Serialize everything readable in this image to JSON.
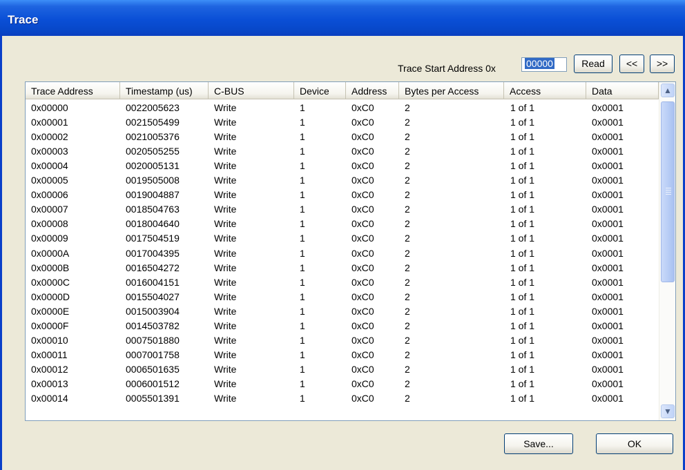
{
  "window": {
    "title": "Trace"
  },
  "toolbar": {
    "start_label": "Trace Start Address 0x",
    "start_value": "00000",
    "read_label": "Read",
    "prev_label": "<<",
    "next_label": ">>"
  },
  "table": {
    "columns": [
      "Trace Address",
      "Timestamp (us)",
      "C-BUS",
      "Device",
      "Address",
      "Bytes per Access",
      "Access",
      "Data"
    ],
    "rows": [
      [
        "0x00000",
        "0022005623",
        "Write",
        "1",
        "0xC0",
        "2",
        "1 of 1",
        "0x0001"
      ],
      [
        "0x00001",
        "0021505499",
        "Write",
        "1",
        "0xC0",
        "2",
        "1 of 1",
        "0x0001"
      ],
      [
        "0x00002",
        "0021005376",
        "Write",
        "1",
        "0xC0",
        "2",
        "1 of 1",
        "0x0001"
      ],
      [
        "0x00003",
        "0020505255",
        "Write",
        "1",
        "0xC0",
        "2",
        "1 of 1",
        "0x0001"
      ],
      [
        "0x00004",
        "0020005131",
        "Write",
        "1",
        "0xC0",
        "2",
        "1 of 1",
        "0x0001"
      ],
      [
        "0x00005",
        "0019505008",
        "Write",
        "1",
        "0xC0",
        "2",
        "1 of 1",
        "0x0001"
      ],
      [
        "0x00006",
        "0019004887",
        "Write",
        "1",
        "0xC0",
        "2",
        "1 of 1",
        "0x0001"
      ],
      [
        "0x00007",
        "0018504763",
        "Write",
        "1",
        "0xC0",
        "2",
        "1 of 1",
        "0x0001"
      ],
      [
        "0x00008",
        "0018004640",
        "Write",
        "1",
        "0xC0",
        "2",
        "1 of 1",
        "0x0001"
      ],
      [
        "0x00009",
        "0017504519",
        "Write",
        "1",
        "0xC0",
        "2",
        "1 of 1",
        "0x0001"
      ],
      [
        "0x0000A",
        "0017004395",
        "Write",
        "1",
        "0xC0",
        "2",
        "1 of 1",
        "0x0001"
      ],
      [
        "0x0000B",
        "0016504272",
        "Write",
        "1",
        "0xC0",
        "2",
        "1 of 1",
        "0x0001"
      ],
      [
        "0x0000C",
        "0016004151",
        "Write",
        "1",
        "0xC0",
        "2",
        "1 of 1",
        "0x0001"
      ],
      [
        "0x0000D",
        "0015504027",
        "Write",
        "1",
        "0xC0",
        "2",
        "1 of 1",
        "0x0001"
      ],
      [
        "0x0000E",
        "0015003904",
        "Write",
        "1",
        "0xC0",
        "2",
        "1 of 1",
        "0x0001"
      ],
      [
        "0x0000F",
        "0014503782",
        "Write",
        "1",
        "0xC0",
        "2",
        "1 of 1",
        "0x0001"
      ],
      [
        "0x00010",
        "0007501880",
        "Write",
        "1",
        "0xC0",
        "2",
        "1 of 1",
        "0x0001"
      ],
      [
        "0x00011",
        "0007001758",
        "Write",
        "1",
        "0xC0",
        "2",
        "1 of 1",
        "0x0001"
      ],
      [
        "0x00012",
        "0006501635",
        "Write",
        "1",
        "0xC0",
        "2",
        "1 of 1",
        "0x0001"
      ],
      [
        "0x00013",
        "0006001512",
        "Write",
        "1",
        "0xC0",
        "2",
        "1 of 1",
        "0x0001"
      ],
      [
        "0x00014",
        "0005501391",
        "Write",
        "1",
        "0xC0",
        "2",
        "1 of 1",
        "0x0001"
      ]
    ]
  },
  "footer": {
    "save_label": "Save...",
    "ok_label": "OK"
  },
  "colors": {
    "titlebar": "#0a4fd6",
    "dialog_bg": "#ece9d8",
    "grid_border": "#7f9db9"
  },
  "icons": {
    "scroll_up": "scroll-up-arrow-icon",
    "scroll_down": "scroll-down-arrow-icon"
  }
}
